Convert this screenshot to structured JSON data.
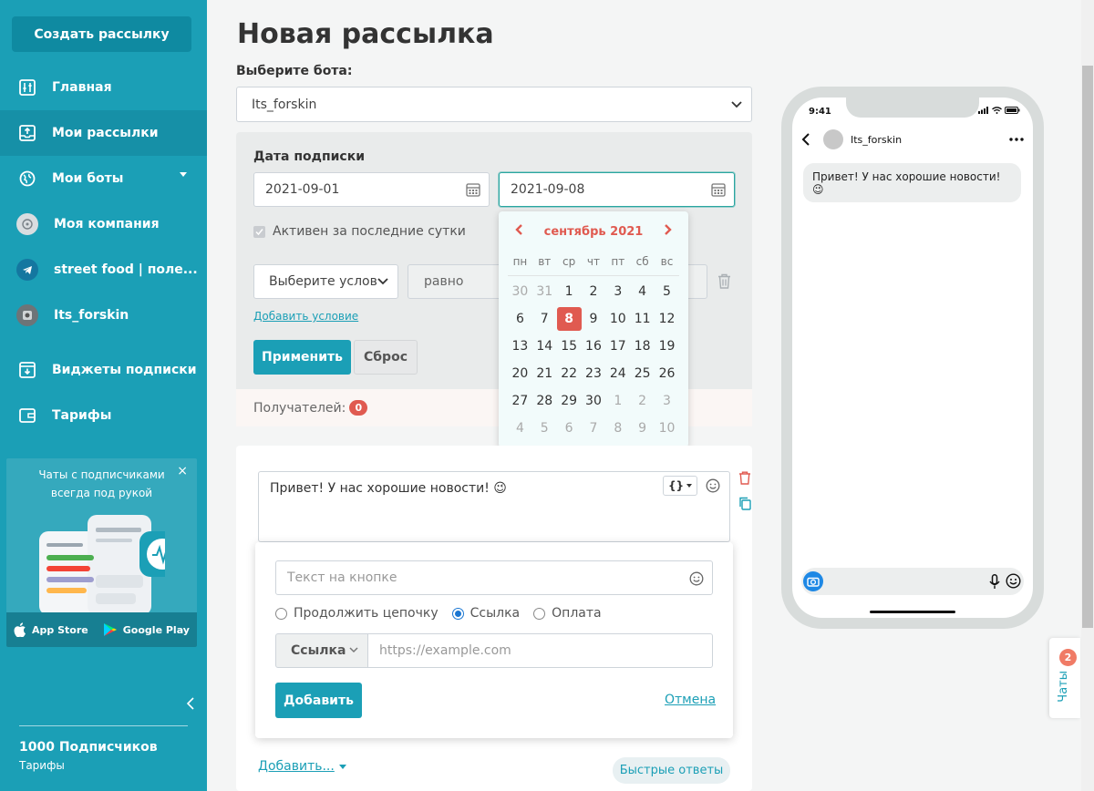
{
  "sidebar": {
    "create_button": "Создать рассылку",
    "items": [
      {
        "label": "Главная"
      },
      {
        "label": "Мои рассылки"
      },
      {
        "label": "Мои боты"
      },
      {
        "label": "Моя компания"
      },
      {
        "label": "street food | поле..."
      },
      {
        "label": "Its_forskin"
      },
      {
        "label": "Виджеты подписки"
      },
      {
        "label": "Тарифы"
      }
    ],
    "promo": {
      "text_line1": "Чаты с подписчиками",
      "text_line2": "всегда под рукой",
      "close": "×",
      "app_store": "App Store",
      "google_play": "Google Play"
    },
    "subscribers": "1000 Подписчиков",
    "plan_link": "Тарифы"
  },
  "main": {
    "title": "Новая рассылка",
    "bot_label": "Выберите бота:",
    "bot_selected": "Its_forskin",
    "filter": {
      "date_label": "Дата подписки",
      "date_from": "2021-09-01",
      "date_to": "2021-09-08",
      "active_label": "Активен за последние сутки",
      "condition_select": "Выберите услов",
      "operator_select": "равно",
      "add_condition": "Добавить условие",
      "apply": "Применить",
      "reset": "Сброс",
      "recipients_label": "Получателей:",
      "recipients_count": "0"
    },
    "calendar": {
      "month": "сентябрь 2021",
      "weekdays": [
        "пн",
        "вт",
        "ср",
        "чт",
        "пт",
        "сб",
        "вс"
      ],
      "weeks": [
        [
          "30",
          "31",
          "1",
          "2",
          "3",
          "4",
          "5"
        ],
        [
          "6",
          "7",
          "8",
          "9",
          "10",
          "11",
          "12"
        ],
        [
          "13",
          "14",
          "15",
          "16",
          "17",
          "18",
          "19"
        ],
        [
          "20",
          "21",
          "22",
          "23",
          "24",
          "25",
          "26"
        ],
        [
          "27",
          "28",
          "29",
          "30",
          "1",
          "2",
          "3"
        ],
        [
          "4",
          "5",
          "6",
          "7",
          "8",
          "9",
          "10"
        ]
      ],
      "selected_day": "8"
    },
    "message": {
      "text": "Привет! У нас хорошие новости! 😉",
      "button_text_placeholder": "Текст на кнопке",
      "radio_options": [
        "Продолжить цепочку",
        "Ссылка",
        "Оплата"
      ],
      "radio_selected": "Ссылка",
      "link_type": "Ссылка",
      "url_placeholder": "https://example.com",
      "add_button": "Добавить",
      "cancel_link": "Отмена",
      "add_more": "Добавить...",
      "quick_replies": "Быстрые ответы"
    }
  },
  "phone": {
    "time": "9:41",
    "chat_name": "Its_forskin",
    "bubble_text": "Привет! У нас хорошие новости! 😉"
  },
  "chats_tab": {
    "label": "Чаты",
    "count": "2"
  },
  "colors": {
    "sidebar": "#1b9fb6",
    "accent_red": "#e05a50",
    "primary": "#1b9fb6"
  }
}
